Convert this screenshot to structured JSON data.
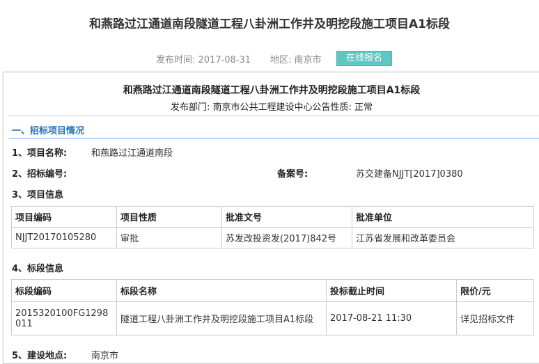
{
  "header": {
    "title": "和燕路过江通道南段隧道工程八卦洲工作井及明挖段施工项目A1标段",
    "publish_time": "发布时间:  2017-08-31",
    "region": "地区:  南京市",
    "signup_label": "在线报名"
  },
  "doc": {
    "title": "和燕路过江通道南段隧道工程八卦洲工作井及明挖段施工项目A1标段",
    "subtitle": "发布部门: 南京市公共工程建设中心公告性质:  正常",
    "section1": "一、招标项目情况",
    "item1_label": "1、项目名称:",
    "item1_value": "和燕路过江通道南段",
    "item2_label": "2、招标编号:",
    "record_label": "备案号:",
    "record_value": "苏交建备NJJT[2017]0380",
    "item3_label": "3、项目信息",
    "item4_label": "4、标段信息",
    "item5_label": "5、建设地点:",
    "item5_value": "南京市"
  },
  "project_table": {
    "headers": [
      "项目编码",
      "项目性质",
      "批准文号",
      "批准单位"
    ],
    "row": [
      "NJJT20170105280",
      "审批",
      "苏发改投资发(2017)842号",
      "江苏省发展和改革委员会"
    ]
  },
  "section_table": {
    "headers": [
      "标段编码",
      "标段名称",
      "投标截止时间",
      "限价/元"
    ],
    "row": [
      "2015320100FG1298011",
      "隧道工程八卦洲工作井及明挖段施工项目A1标段",
      "2017-08-21 11:30",
      "详见招标文件"
    ]
  }
}
